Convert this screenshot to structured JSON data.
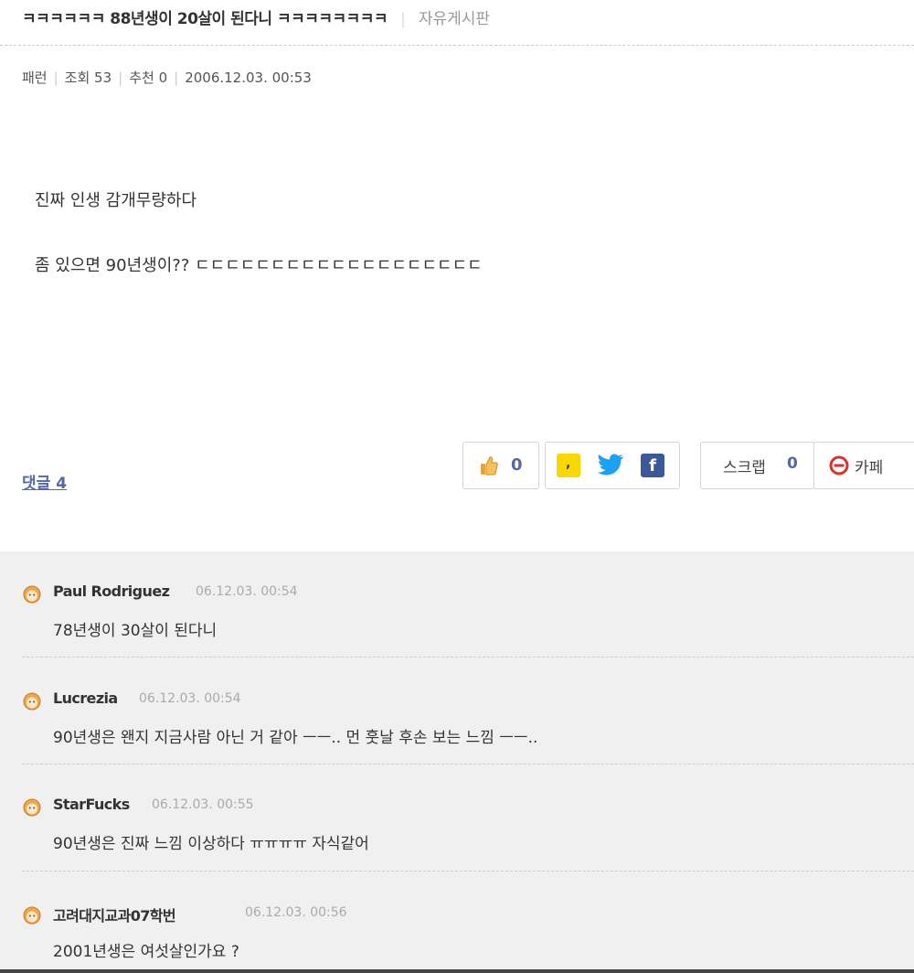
{
  "post": {
    "title": "ㅋㅋㅋㅋㅋㅋ 88년생이 20살이 된다니 ㅋㅋㅋㅋㅋㅋㅋㅋ",
    "board": "자유게시판",
    "author": "패런",
    "views": "조회 53",
    "recommend": "추천 0",
    "date": "2006.12.03. 00:53",
    "body": [
      "진짜 인생 감개무량하다",
      "좀 있으면 90년생이?? ㄷㄷㄷㄷㄷㄷㄷㄷㄷㄷㄷㄷㄷㄷㄷㄷㄷㄷㄷ"
    ]
  },
  "actions": {
    "comments_label": "댓글 4",
    "like_count": "0",
    "scrap_label": "스크랩",
    "scrap_count": "0",
    "cafe_label": "카페",
    "icons": [
      "thumbs-up-icon",
      "kakao-icon",
      "twitter-icon",
      "facebook-icon",
      "cafe-icon"
    ],
    "colors": {
      "accent": "#5468a6",
      "kakao": "#f7d800",
      "twitter": "#1da1f2",
      "facebook": "#3b5998",
      "cafe": "#d9342b"
    }
  },
  "comments": [
    {
      "author": "Paul Rodriguez",
      "date": "06.12.03. 00:54",
      "text": "78년생이 30살이 된다니"
    },
    {
      "author": "Lucrezia",
      "date": "06.12.03. 00:54",
      "text": "90년생은 왠지 지금사람 아닌 거 같아 ㅡㅡ.. 먼 훗날 후손 보는 느낌 ㅡㅡ.."
    },
    {
      "author": "StarFucks",
      "date": "06.12.03. 00:55",
      "text": "90년생은 진짜 느낌 이상하다 ㅠㅠㅠㅠ 자식같어"
    },
    {
      "author": "고려대지교과07학번",
      "date": "06.12.03. 00:56",
      "text": "2001년생은 여섯살인가요 ?"
    }
  ]
}
